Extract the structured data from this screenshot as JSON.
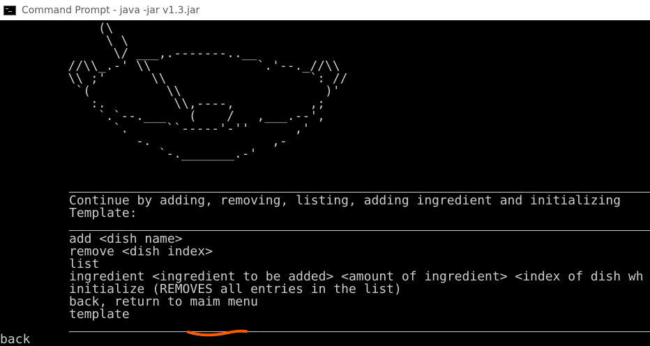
{
  "window": {
    "title": "Command Prompt - java  -jar v1.3.jar",
    "icon": "cmd-icon"
  },
  "console": {
    "ascii_art": "             (\\\n              \\ \\\n               \\/ ___,.-------..__\n         //\\\\_.-' \\\\              `.'--._//\\\\\n         \\\\ ;'      \\\\                   `: //\n          `(          \\\\                   )'\n            :.         \\\\,----,          ,;\n             `.`--.___   (    /   ,___.--',\n               `.     ``-----'-''      ,'\n                  -.                ,-\n                     `-._______.-'",
    "separator": "Continue by adding, removing, listing, adding ingredient and initializing\nTemplate:",
    "commands": [
      "add <dish name>",
      "remove <dish index>",
      "list",
      "ingredient <ingredient to be added> <amount of ingredient> <index of dish wh",
      "initialize (REMOVES all entries in the list)",
      "back, return to maim menu",
      "template"
    ],
    "user_input": "back"
  },
  "annotation": {
    "color": "#ff5a00",
    "note_target": "maim"
  }
}
